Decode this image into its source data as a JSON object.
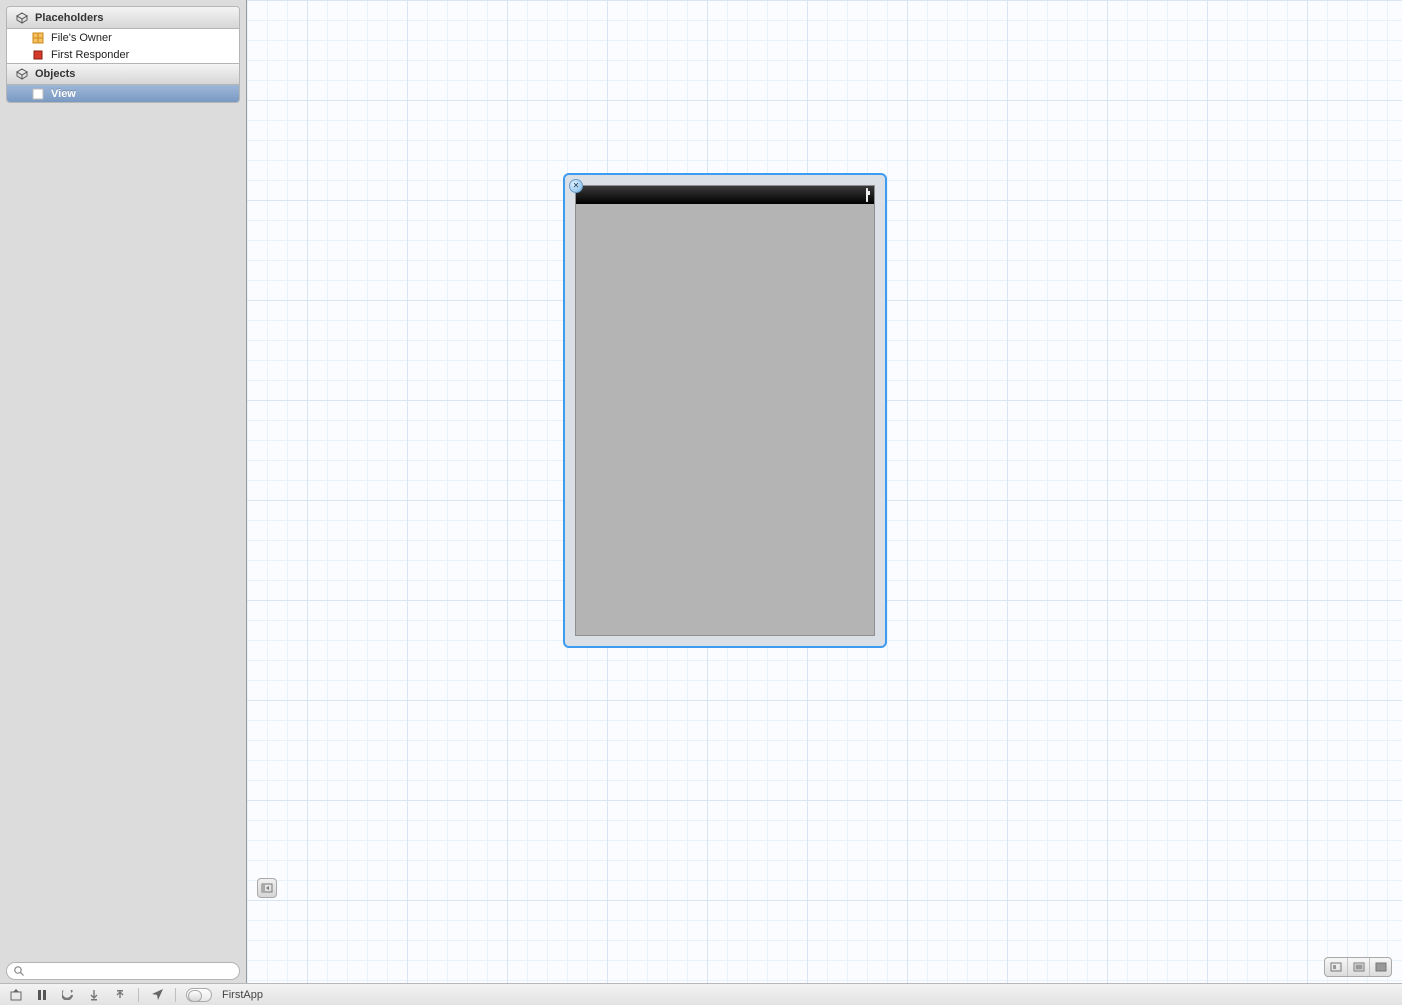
{
  "sidebar": {
    "sections": {
      "placeholders": {
        "title": "Placeholders",
        "items": [
          {
            "label": "File's Owner"
          },
          {
            "label": "First Responder"
          }
        ]
      },
      "objects": {
        "title": "Objects",
        "items": [
          {
            "label": "View",
            "selected": true
          }
        ]
      }
    },
    "filter": {
      "placeholder": ""
    }
  },
  "canvas": {
    "selected_object": "View"
  },
  "statusbar": {
    "project_name": "FirstApp"
  }
}
